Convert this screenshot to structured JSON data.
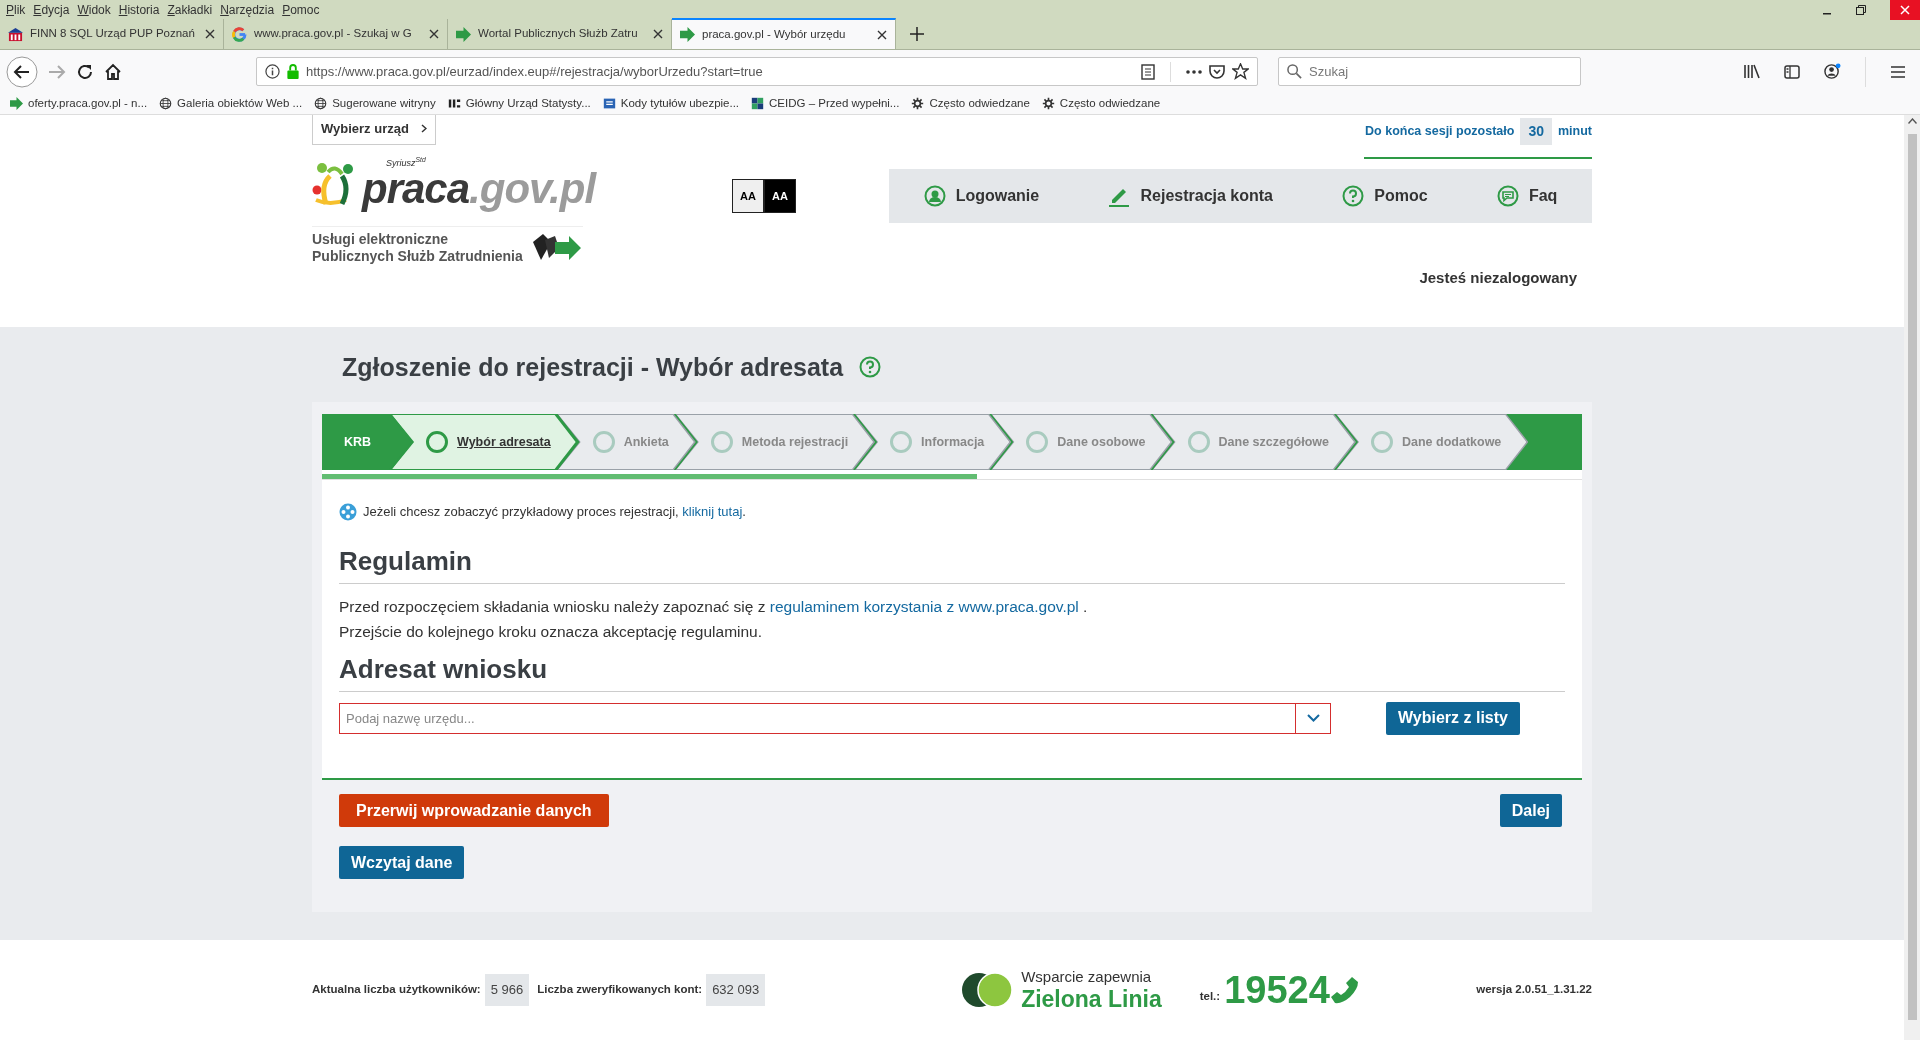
{
  "browser": {
    "menu": [
      "Plik",
      "Edycja",
      "Widok",
      "Historia",
      "Zakładki",
      "Narzędzia",
      "Pomoc"
    ],
    "tabs": [
      {
        "title": "FINN 8 SQL Urząd PUP Poznań",
        "selected": false
      },
      {
        "title": "www.praca.gov.pl - Szukaj w G",
        "selected": false
      },
      {
        "title": "Wortal Publicznych Służb Zatru",
        "selected": false
      },
      {
        "title": "praca.gov.pl - Wybór urzędu",
        "selected": true
      }
    ],
    "url": "https://www.praca.gov.pl/eurzad/index.eup#/rejestracja/wyborUrzedu?start=true",
    "search": {
      "placeholder": "Szukaj"
    },
    "bookmarks": [
      "oferty.praca.gov.pl - n...",
      "Galeria obiektów Web ...",
      "Sugerowane witryny",
      "Główny Urząd Statysty...",
      "Kody tytułów ubezpie...",
      "CEIDG – Przed wypełni...",
      "Często odwiedzane",
      "Często odwiedzane"
    ]
  },
  "header": {
    "office_button": "Wybierz urząd",
    "session": {
      "label": "Do końca sesji pozostało",
      "minutes": "30",
      "unit": "minut"
    },
    "logo": {
      "mark": "Syriusz$^{Std}$",
      "name": "**praca**.gov.pl",
      "tagline": [
        "Usługi elektroniczne",
        "Publicznych Służb Zatrudnienia"
      ]
    },
    "contrast": [
      {
        "label": "AA",
        "kind": "normal"
      },
      {
        "label": "AA",
        "kind": "high"
      }
    ],
    "nav": [
      "Logowanie",
      "Rejestracja konta",
      "Pomoc",
      "Faq"
    ],
    "status": "Jesteś niezalogowany"
  },
  "page": {
    "title": "Zgłoszenie do rejestracji - Wybór adresata",
    "steps": [
      {
        "label": "KRB",
        "kind": "start",
        "selected": false
      },
      {
        "label": "Wybór adresata",
        "kind": "step",
        "selected": true
      },
      {
        "label": "Ankieta",
        "kind": "step",
        "selected": false
      },
      {
        "label": "Metoda rejestracji",
        "kind": "step",
        "selected": false
      },
      {
        "label": "Informacja",
        "kind": "step",
        "selected": false
      },
      {
        "label": "Dane osobowe",
        "kind": "step",
        "selected": false
      },
      {
        "label": "Dane szczegółowe",
        "kind": "step",
        "selected": false
      },
      {
        "label": "Dane dodatkowe",
        "kind": "step",
        "selected": false
      }
    ],
    "progress": {
      "level": 0.52
    },
    "info": {
      "text": "Jeżeli chcesz zobaczyć przykładowy proces rejestracji,",
      "link": "kliknij tutaj",
      "end": "."
    },
    "rules": {
      "heading": "Regulamin",
      "lines": [
        {
          "text": "Przed rozpoczęciem składania wniosku należy zapoznać się z",
          "link": "regulaminem korzystania z www.praca.gov.pl",
          "end": " ."
        },
        {
          "text": "Przejście do kolejnego kroku oznacza akceptację regulaminu."
        }
      ]
    },
    "addressee": {
      "heading": "Adresat wniosku",
      "field": {
        "placeholder": "Podaj nazwę urzędu...",
        "invalid": true
      },
      "pick_button": "Wybierz z listy"
    },
    "buttons": [
      {
        "label": "Przerwij wprowadzanie danych",
        "kind": "danger"
      },
      {
        "label": "Dalej",
        "kind": "primary"
      },
      {
        "label": "Wczytaj dane",
        "kind": "primary"
      }
    ]
  },
  "footer": {
    "users_label": "Aktualna liczba użytkowników:",
    "users": "5 966",
    "verified_label": "Liczba zweryfikowanych kont:",
    "verified": "632 093",
    "support": "Wsparcie zapewnia",
    "line": "Zielona Linia",
    "tel_label": "tel.:",
    "tel": "19524",
    "version": "wersja 2.0.51_1.31.22"
  }
}
